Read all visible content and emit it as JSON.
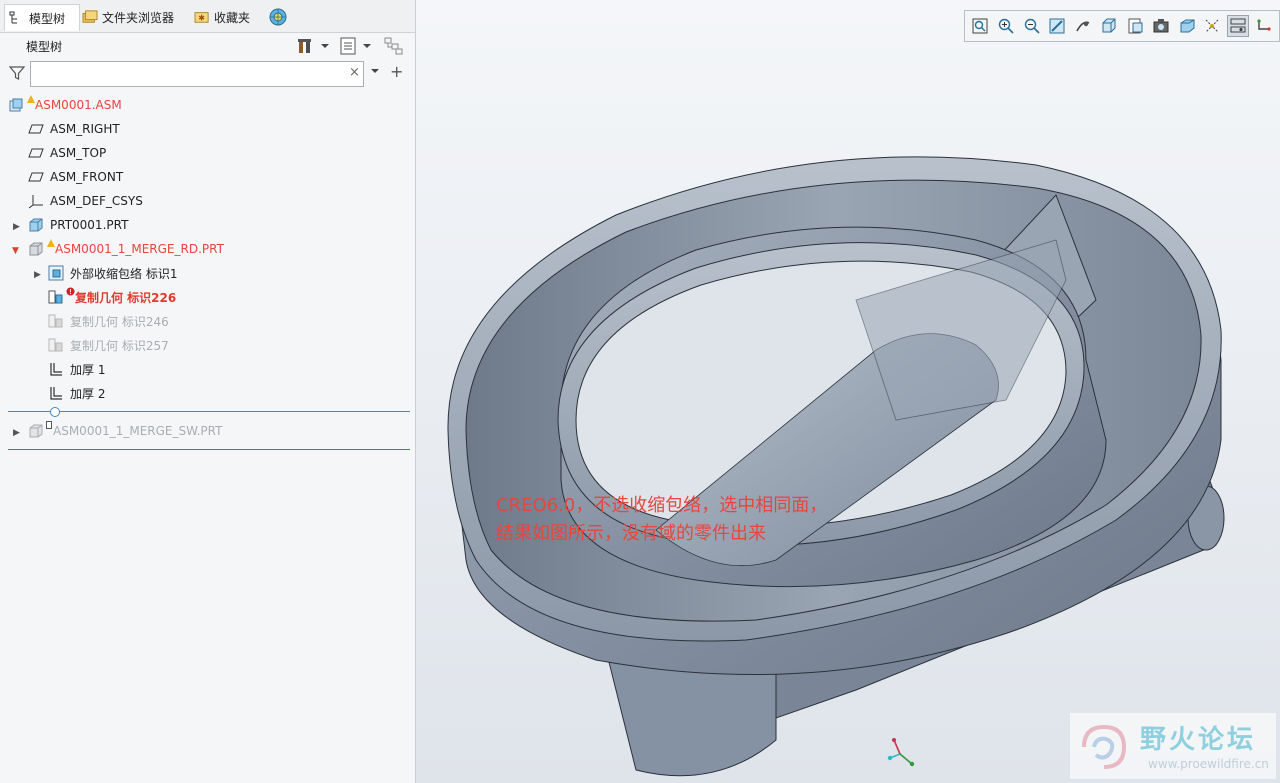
{
  "tabs": [
    {
      "label": "模型树"
    },
    {
      "label": "文件夹浏览器"
    },
    {
      "label": "收藏夹"
    }
  ],
  "panel": {
    "title": "模型树",
    "search_value": "",
    "clear_glyph": "×",
    "add_glyph": "+"
  },
  "tree": [
    {
      "label": "ASM0001.ASM",
      "icon": "assembly-icon",
      "warning": true,
      "style": "red"
    },
    {
      "label": "ASM_RIGHT",
      "icon": "datum-plane-icon"
    },
    {
      "label": "ASM_TOP",
      "icon": "datum-plane-icon"
    },
    {
      "label": "ASM_FRONT",
      "icon": "datum-plane-icon"
    },
    {
      "label": "ASM_DEF_CSYS",
      "icon": "csys-icon"
    },
    {
      "label": "PRT0001.PRT",
      "icon": "part-icon",
      "expander": "collapsed"
    },
    {
      "label": "ASM0001_1_MERGE_RD.PRT",
      "icon": "part-icon",
      "warning": true,
      "style": "red",
      "expander": "expanded"
    },
    {
      "label": "外部收缩包络 标识1",
      "icon": "shrinkwrap-icon",
      "expander": "collapsed"
    },
    {
      "label": "复制几何 标识226",
      "icon": "copy-geom-icon",
      "error": true,
      "style": "bold-red"
    },
    {
      "label": "复制几何 标识246",
      "icon": "copy-geom-icon",
      "style": "grey"
    },
    {
      "label": "复制几何 标识257",
      "icon": "copy-geom-icon",
      "style": "grey"
    },
    {
      "label": "加厚 1",
      "icon": "thicken-icon"
    },
    {
      "label": "加厚 2",
      "icon": "thicken-icon"
    },
    {
      "label": "ASM0001_1_MERGE_SW.PRT",
      "icon": "part-icon",
      "style": "grey",
      "expander": "collapsed",
      "suppressed_mark": true
    }
  ],
  "annotation": {
    "line1": "CREO6.0，不选收缩包络，选中相同面，",
    "line2": "结果如图所示，没有域的零件出来"
  },
  "watermark": {
    "title": "野火论坛",
    "url": "www.proewildfire.cn"
  },
  "colors": {
    "accent_red": "#e8453c",
    "model_body": "#8a96a6",
    "insert_line": "#4a86b8",
    "green_line": "#2f9b3a"
  }
}
